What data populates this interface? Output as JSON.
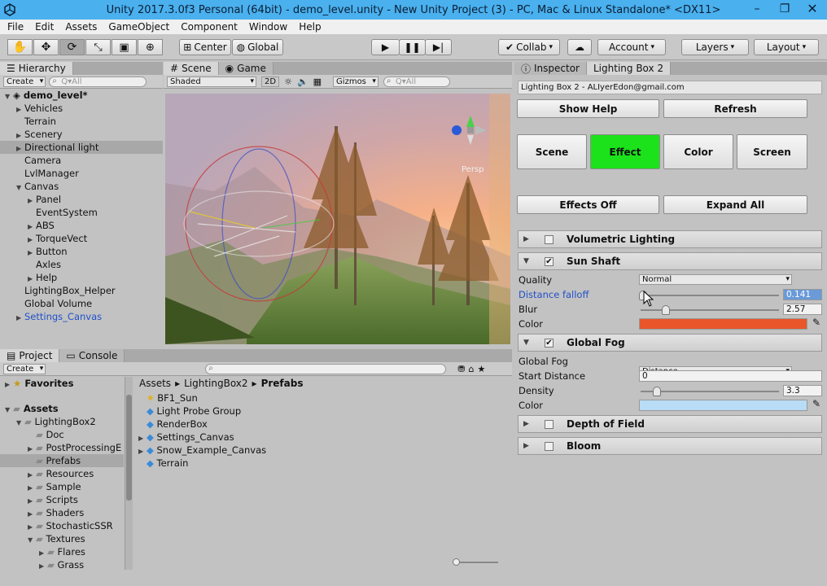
{
  "window": {
    "title": "Unity 2017.3.0f3 Personal (64bit) - demo_level.unity - New Unity Project (3) - PC, Mac & Linux Standalone* <DX11>"
  },
  "menu": [
    "File",
    "Edit",
    "Assets",
    "GameObject",
    "Component",
    "Window",
    "Help"
  ],
  "toolbar": {
    "pivot": "Center",
    "space": "Global",
    "collab": "Collab",
    "account": "Account",
    "layers": "Layers",
    "layout": "Layout"
  },
  "hierarchy": {
    "tab": "Hierarchy",
    "create": "Create",
    "search": "Q▾All",
    "scene": "demo_level*",
    "items": [
      {
        "label": "Vehicles",
        "d": 1,
        "exp": "closed"
      },
      {
        "label": "Terrain",
        "d": 1
      },
      {
        "label": "Scenery",
        "d": 1,
        "exp": "closed"
      },
      {
        "label": "Directional light",
        "d": 1,
        "exp": "closed",
        "sel": true
      },
      {
        "label": "Camera",
        "d": 1
      },
      {
        "label": "LvlManager",
        "d": 1
      },
      {
        "label": "Canvas",
        "d": 1,
        "exp": "open"
      },
      {
        "label": "Panel",
        "d": 2,
        "exp": "closed"
      },
      {
        "label": "EventSystem",
        "d": 2
      },
      {
        "label": "ABS",
        "d": 2,
        "exp": "closed"
      },
      {
        "label": "TorqueVect",
        "d": 2,
        "exp": "closed"
      },
      {
        "label": "Button",
        "d": 2,
        "exp": "closed"
      },
      {
        "label": "Axles",
        "d": 2
      },
      {
        "label": "Help",
        "d": 2,
        "exp": "closed"
      },
      {
        "label": "LightingBox_Helper",
        "d": 1
      },
      {
        "label": "Global Volume",
        "d": 1
      },
      {
        "label": "Settings_Canvas",
        "d": 1,
        "exp": "closed",
        "blue": true
      }
    ]
  },
  "scene": {
    "tab_scene": "Scene",
    "tab_game": "Game",
    "shading": "Shaded",
    "mode2d": "2D",
    "gizmos": "Gizmos",
    "search": "Q▾All",
    "persp": "Persp"
  },
  "project": {
    "tab": "Project",
    "tab_console": "Console",
    "create": "Create",
    "favorites": "Favorites",
    "assets": "Assets",
    "tree": [
      {
        "label": "LightingBox2",
        "d": 1,
        "exp": "open"
      },
      {
        "label": "Doc",
        "d": 2
      },
      {
        "label": "PostProcessingE",
        "d": 2,
        "exp": "closed"
      },
      {
        "label": "Prefabs",
        "d": 2,
        "sel": true
      },
      {
        "label": "Resources",
        "d": 2,
        "exp": "closed"
      },
      {
        "label": "Sample",
        "d": 2,
        "exp": "closed"
      },
      {
        "label": "Scripts",
        "d": 2,
        "exp": "closed"
      },
      {
        "label": "Shaders",
        "d": 2,
        "exp": "closed"
      },
      {
        "label": "StochasticSSR",
        "d": 2,
        "exp": "closed"
      },
      {
        "label": "Textures",
        "d": 2,
        "exp": "open"
      },
      {
        "label": "Flares",
        "d": 3,
        "exp": "closed"
      },
      {
        "label": "Grass",
        "d": 3,
        "exp": "closed"
      }
    ],
    "breadcrumb": [
      "Assets",
      "LightingBox2",
      "Prefabs"
    ],
    "files": [
      {
        "label": "BF1_Sun",
        "icon": "sun"
      },
      {
        "label": "Light Probe Group",
        "icon": "cube"
      },
      {
        "label": "RenderBox",
        "icon": "cube"
      },
      {
        "label": "Settings_Canvas",
        "icon": "cube",
        "exp": true
      },
      {
        "label": "Snow_Example_Canvas",
        "icon": "cube",
        "exp": true
      },
      {
        "label": "Terrain",
        "icon": "cube"
      }
    ]
  },
  "inspector": {
    "tab_inspector": "Inspector",
    "tab_lb": "Lighting Box 2",
    "header": "Lighting Box 2 - ALIyerEdon@gmail.com",
    "show_help": "Show Help",
    "refresh": "Refresh",
    "modes": [
      "Scene",
      "Effect",
      "Color",
      "Screen"
    ],
    "effects_off": "Effects Off",
    "expand_all": "Expand All",
    "volumetric": "Volumetric Lighting",
    "sunshaft": {
      "title": "Sun Shaft",
      "quality_label": "Quality",
      "quality": "Normal",
      "falloff_label": "Distance falloff",
      "falloff": "0.141",
      "falloff_frac": 0.02,
      "blur_label": "Blur",
      "blur": "2.57",
      "blur_frac": 0.18,
      "color_label": "Color",
      "color": "#e8562a"
    },
    "fog": {
      "title": "Global Fog",
      "mode_label": "Global Fog",
      "mode": "Distance",
      "start_label": "Start Distance",
      "start": "0",
      "density_label": "Density",
      "density": "3.3",
      "density_frac": 0.12,
      "color_label": "Color",
      "color": "#b9dcf7"
    },
    "dof": "Depth of Field",
    "bloom": "Bloom"
  },
  "colors": {
    "effect_active": "#1be21b",
    "accent": "#4ab0ee"
  }
}
